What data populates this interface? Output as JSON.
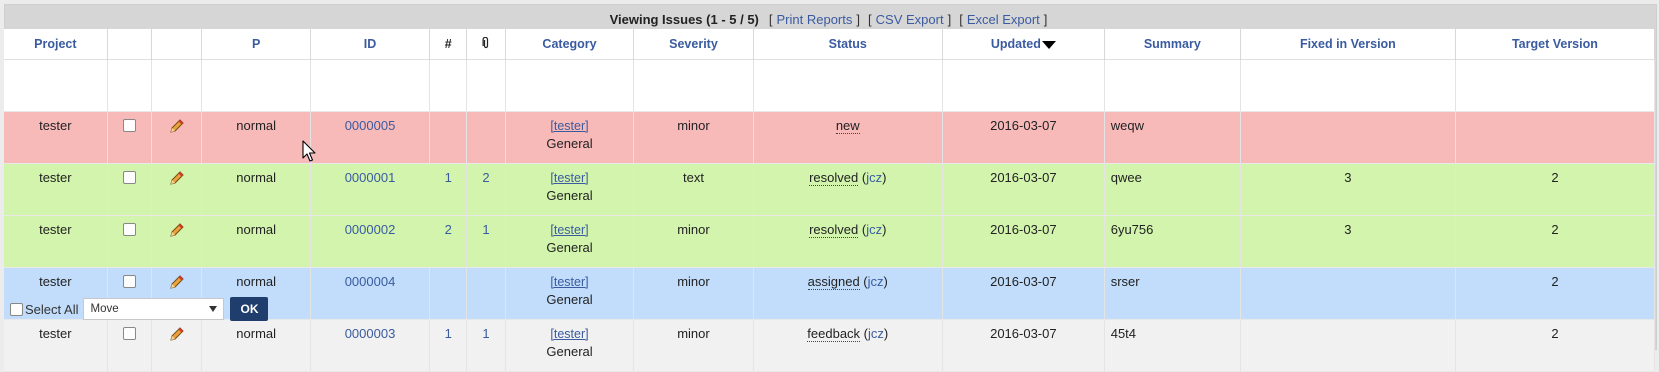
{
  "title": "Viewing Issues (1 - 5 / 5)",
  "links": {
    "print_reports": "Print Reports",
    "csv_export": "CSV Export",
    "excel_export": "Excel Export"
  },
  "columns": {
    "project": "Project",
    "priority": "P",
    "id": "ID",
    "notes": "#",
    "category": "Category",
    "severity": "Severity",
    "status": "Status",
    "updated": "Updated",
    "summary": "Summary",
    "fixed_in_version": "Fixed in Version",
    "target_version": "Target Version"
  },
  "issues": [
    {
      "project": "tester",
      "priority": "normal",
      "id": "0000005",
      "notes": "",
      "attachments": "",
      "category_project": "[tester]",
      "category": "General",
      "severity": "minor",
      "status": "new",
      "handler": "",
      "updated": "2016-03-07",
      "summary": "weqw",
      "fixed_in_version": "",
      "target_version": ""
    },
    {
      "project": "tester",
      "priority": "normal",
      "id": "0000001",
      "notes": "1",
      "attachments": "2",
      "category_project": "[tester]",
      "category": "General",
      "severity": "text",
      "status": "resolved",
      "handler": "jcz",
      "updated": "2016-03-07",
      "summary": "qwee",
      "fixed_in_version": "3",
      "target_version": "2"
    },
    {
      "project": "tester",
      "priority": "normal",
      "id": "0000002",
      "notes": "2",
      "attachments": "1",
      "category_project": "[tester]",
      "category": "General",
      "severity": "minor",
      "status": "resolved",
      "handler": "jcz",
      "updated": "2016-03-07",
      "summary": "6yu756",
      "fixed_in_version": "3",
      "target_version": "2"
    },
    {
      "project": "tester",
      "priority": "normal",
      "id": "0000004",
      "notes": "",
      "attachments": "",
      "category_project": "[tester]",
      "category": "General",
      "severity": "minor",
      "status": "assigned",
      "handler": "jcz",
      "updated": "2016-03-07",
      "summary": "srser",
      "fixed_in_version": "",
      "target_version": "2"
    },
    {
      "project": "tester",
      "priority": "normal",
      "id": "0000003",
      "notes": "1",
      "attachments": "1",
      "category_project": "[tester]",
      "category": "General",
      "severity": "minor",
      "status": "feedback",
      "handler": "jcz",
      "updated": "2016-03-07",
      "summary": "45t4",
      "fixed_in_version": "",
      "target_version": "2"
    }
  ],
  "footer": {
    "select_all": "Select All",
    "action_value": "Move",
    "ok": "OK"
  },
  "colors": {
    "new": "#f8b9b9",
    "resolved": "#d2f4ad",
    "assigned": "#c1ddfb",
    "feedback": "#f1f1f1",
    "link": "#3a5ba0",
    "button": "#1f3e6e"
  },
  "icons": {
    "edit": "pencil-icon",
    "attachments": "paperclip-icon",
    "sort": "sort-desc-icon",
    "cursor": "mouse-cursor-icon"
  }
}
